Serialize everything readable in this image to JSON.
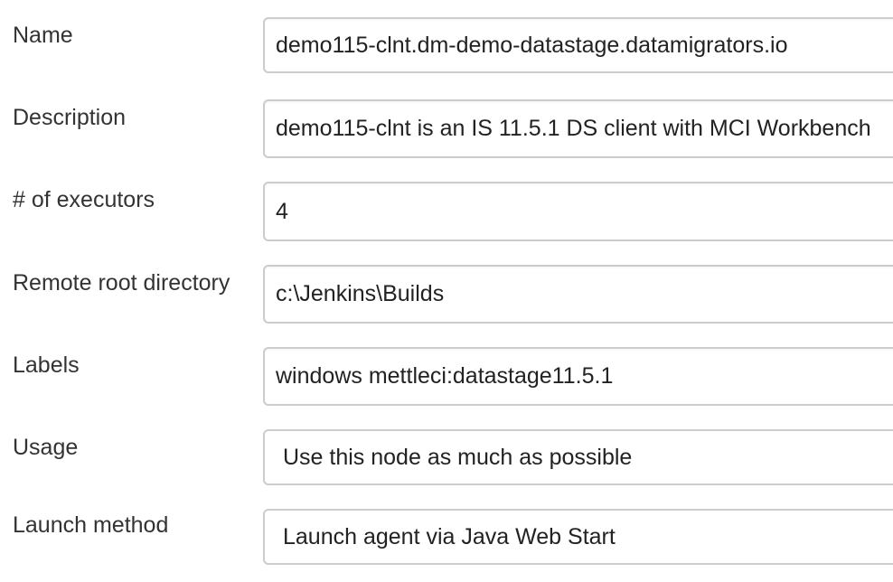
{
  "fields": {
    "name": {
      "label": "Name",
      "value": "demo115-clnt.dm-demo-datastage.datamigrators.io"
    },
    "description": {
      "label": "Description",
      "value": "demo115-clnt is an IS 11.5.1 DS client with MCI Workbench"
    },
    "executors": {
      "label": "# of executors",
      "value": "4"
    },
    "remote_root": {
      "label": "Remote root directory",
      "value": "c:\\Jenkins\\Builds"
    },
    "labels": {
      "label": "Labels",
      "value": "windows mettleci:datastage11.5.1"
    },
    "usage": {
      "label": "Usage",
      "value": "Use this node as much as possible"
    },
    "launch_method": {
      "label": "Launch method",
      "value": "Launch agent via Java Web Start"
    }
  }
}
